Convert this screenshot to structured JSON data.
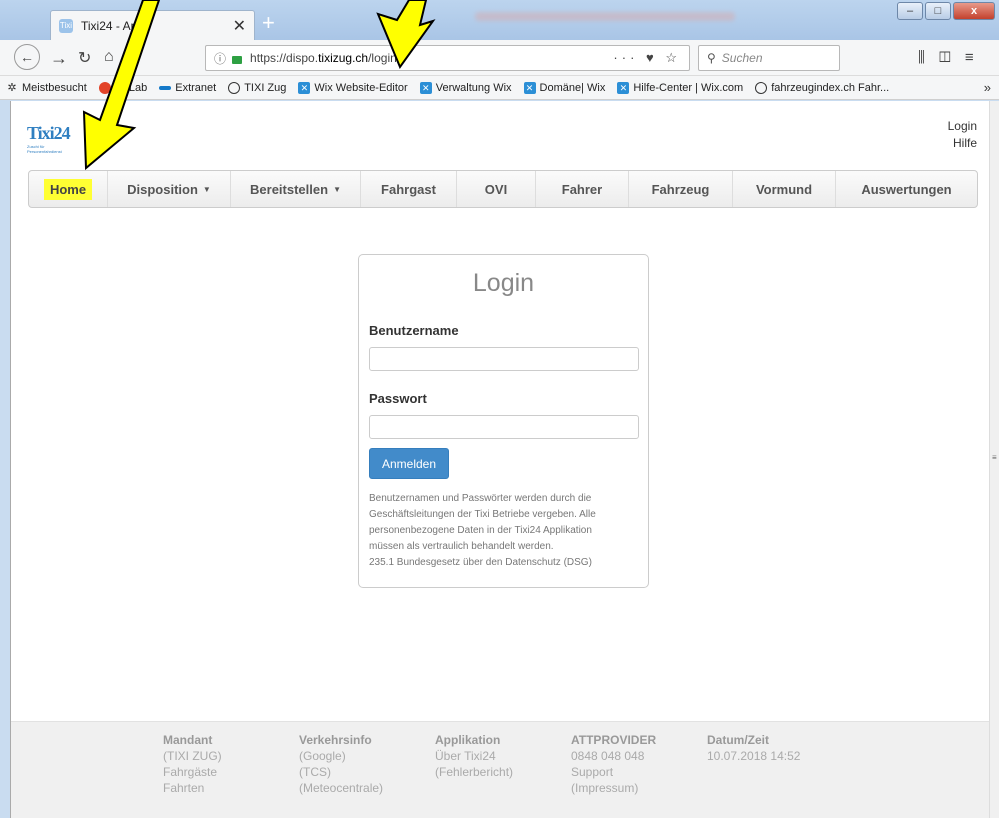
{
  "browser": {
    "tab_title": "Tixi24 - App",
    "tab_icon_text": "Tixi",
    "tab_close": "✕",
    "new_tab": "+",
    "url_prefix": "https://dispo.",
    "url_domain": "tixizug.ch",
    "url_path": "/login",
    "url_actions": "··· ♥ ☆",
    "search_placeholder": "Suchen",
    "bookmarks": [
      {
        "label": "Meistbesucht",
        "icon": "star-icon"
      },
      {
        "label": "GitLab",
        "icon": "gitlab-icon"
      },
      {
        "label": "Extranet",
        "icon": "extranet-icon"
      },
      {
        "label": "TIXI Zug",
        "icon": "globe-icon"
      },
      {
        "label": "Wix Website-Editor",
        "icon": "wix-icon"
      },
      {
        "label": "Verwaltung Wix",
        "icon": "wix-icon"
      },
      {
        "label": "Domäne| Wix",
        "icon": "wix-icon"
      },
      {
        "label": "Hilfe-Center | Wix.com",
        "icon": "wix-icon"
      },
      {
        "label": "fahrzeugindex.ch Fahr...",
        "icon": "globe-icon"
      }
    ],
    "bookmarks_more": "»"
  },
  "site": {
    "logo_text": "Tixi24",
    "logo_sub": "Zuschi für Personenfahrdienst",
    "top_links": {
      "login": "Login",
      "help": "Hilfe"
    },
    "menu": [
      {
        "label": "Home",
        "dropdown": false,
        "highlighted": true
      },
      {
        "label": "Disposition",
        "dropdown": true
      },
      {
        "label": "Bereitstellen",
        "dropdown": true
      },
      {
        "label": "Fahrgast",
        "dropdown": false
      },
      {
        "label": "OVI",
        "dropdown": false
      },
      {
        "label": "Fahrer",
        "dropdown": false
      },
      {
        "label": "Fahrzeug",
        "dropdown": false
      },
      {
        "label": "Vormund",
        "dropdown": false
      },
      {
        "label": "Auswertungen",
        "dropdown": false
      }
    ]
  },
  "login": {
    "title": "Login",
    "username_label": "Benutzername",
    "username_value": "",
    "password_label": "Passwort",
    "password_value": "",
    "submit_label": "Anmelden",
    "note_lines": [
      "Benutzernamen und Passwörter werden durch die",
      "Geschäftsleitungen der Tixi Betriebe vergeben. Alle",
      "personenbezogene Daten in der Tixi24 Applikation",
      "müssen als vertraulich behandelt werden.",
      "235.1 Bundesgesetz über den Datenschutz (DSG)"
    ]
  },
  "footer": {
    "columns": [
      {
        "heading": "Mandant",
        "lines": [
          "(TIXI ZUG)",
          "Fahrgäste",
          "Fahrten"
        ]
      },
      {
        "heading": "Verkehrsinfo",
        "lines": [
          "(Google)",
          "(TCS)",
          "(Meteocentrale)"
        ]
      },
      {
        "heading": "Applikation",
        "lines": [
          "Über Tixi24",
          "(Fehlerbericht)"
        ]
      },
      {
        "heading": "ATTPROVIDER",
        "lines": [
          "0848 048 048",
          "Support",
          "(Impressum)"
        ]
      },
      {
        "heading": "Datum/Zeit",
        "lines": [
          "10.07.2018 14:52"
        ]
      }
    ]
  },
  "colors": {
    "arrow_fill": "#ffff00",
    "highlight": "#ffff33",
    "primary_button": "#428bca"
  }
}
